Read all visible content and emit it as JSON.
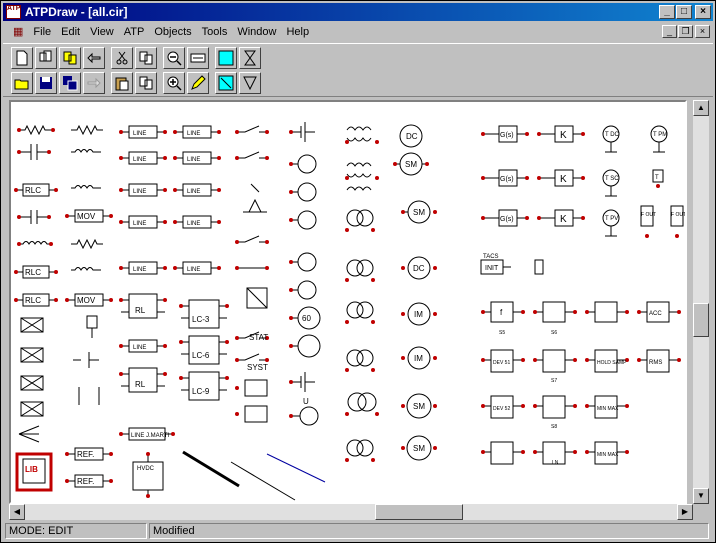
{
  "window": {
    "title": "ATPDraw - [all.cir]",
    "app_icon_text": "ATP"
  },
  "title_buttons": {
    "minimize": "_",
    "maximize": "□",
    "close": "×"
  },
  "menu": [
    "File",
    "Edit",
    "View",
    "ATP",
    "Objects",
    "Tools",
    "Window",
    "Help"
  ],
  "mdi_buttons": {
    "minimize": "_",
    "restore": "❐",
    "close": "×"
  },
  "toolbar_icons": [
    "new-icon",
    "open-icon",
    "save-icon",
    "save-all-icon",
    "copy-icon",
    "paste-icon",
    "zoom-out-icon",
    "zoom-in-icon",
    "text-icon",
    "draw-icon",
    "select-icon",
    "rotate-icon",
    "flip-icon",
    "help-icon"
  ],
  "status": {
    "mode": "MODE: EDIT",
    "modified": "Modified"
  },
  "palette_labels": {
    "rlc": "RLC",
    "mov": "MOV",
    "line_pi": "LINE",
    "line_rl": "RL",
    "lc3": "LC-3",
    "lc6": "LC-6",
    "lc9": "LC-9",
    "jmarti": "LINE J.MARTI",
    "ref": "REF.",
    "hvdc": "HVDC",
    "stat": "STAT",
    "syst": "SYST",
    "u": "U",
    "sixty": "60",
    "dc": "DC",
    "sm": "SM",
    "im": "IM",
    "g_s": "G(s)",
    "k": "K",
    "tacs_init": "INIT",
    "tacs_label": "TACS",
    "f": "f",
    "rms": "RMS",
    "acc": "ACC",
    "dev51": "DEV 51",
    "dev52": "DEV 52",
    "min_max": "MIN MAX",
    "hold": "HOLD SAMP",
    "lib": "LIB",
    "t_dc": "T DC",
    "t_pm": "T PM",
    "t_pv": "T PV",
    "t_sc": "T SC",
    "t": "T",
    "f_out": "F OUT",
    "s5": "S5",
    "s6": "S6",
    "s7": "S7",
    "s8": "S8",
    "ln": "LN"
  }
}
